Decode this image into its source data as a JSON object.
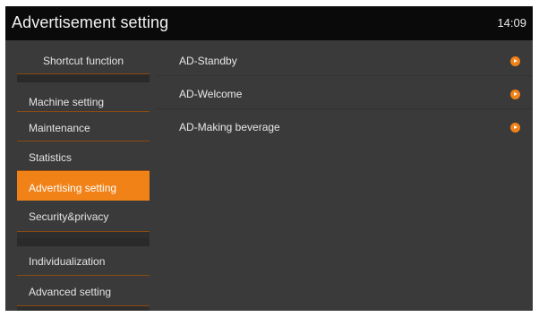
{
  "header": {
    "title": "Advertisement setting",
    "time": "14:09"
  },
  "sidebar": {
    "items": [
      {
        "label": "Shortcut function",
        "active": false
      },
      {
        "label": "Machine setting",
        "active": false
      },
      {
        "label": "Maintenance",
        "active": false
      },
      {
        "label": "Statistics",
        "active": false
      },
      {
        "label": "Advertising setting",
        "active": true
      },
      {
        "label": "Security&privacy",
        "active": false
      },
      {
        "label": "Individualization",
        "active": false
      },
      {
        "label": "Advanced setting",
        "active": false
      }
    ]
  },
  "main": {
    "rows": [
      {
        "label": "AD-Standby",
        "icon": "chevron-right-circle-icon"
      },
      {
        "label": "AD-Welcome",
        "icon": "chevron-right-circle-icon"
      },
      {
        "label": "AD-Making beverage",
        "icon": "chevron-right-circle-icon"
      }
    ]
  },
  "colors": {
    "accent": "#f08218",
    "titlebar": "#0a0a0a",
    "background": "#3a3a3a"
  }
}
